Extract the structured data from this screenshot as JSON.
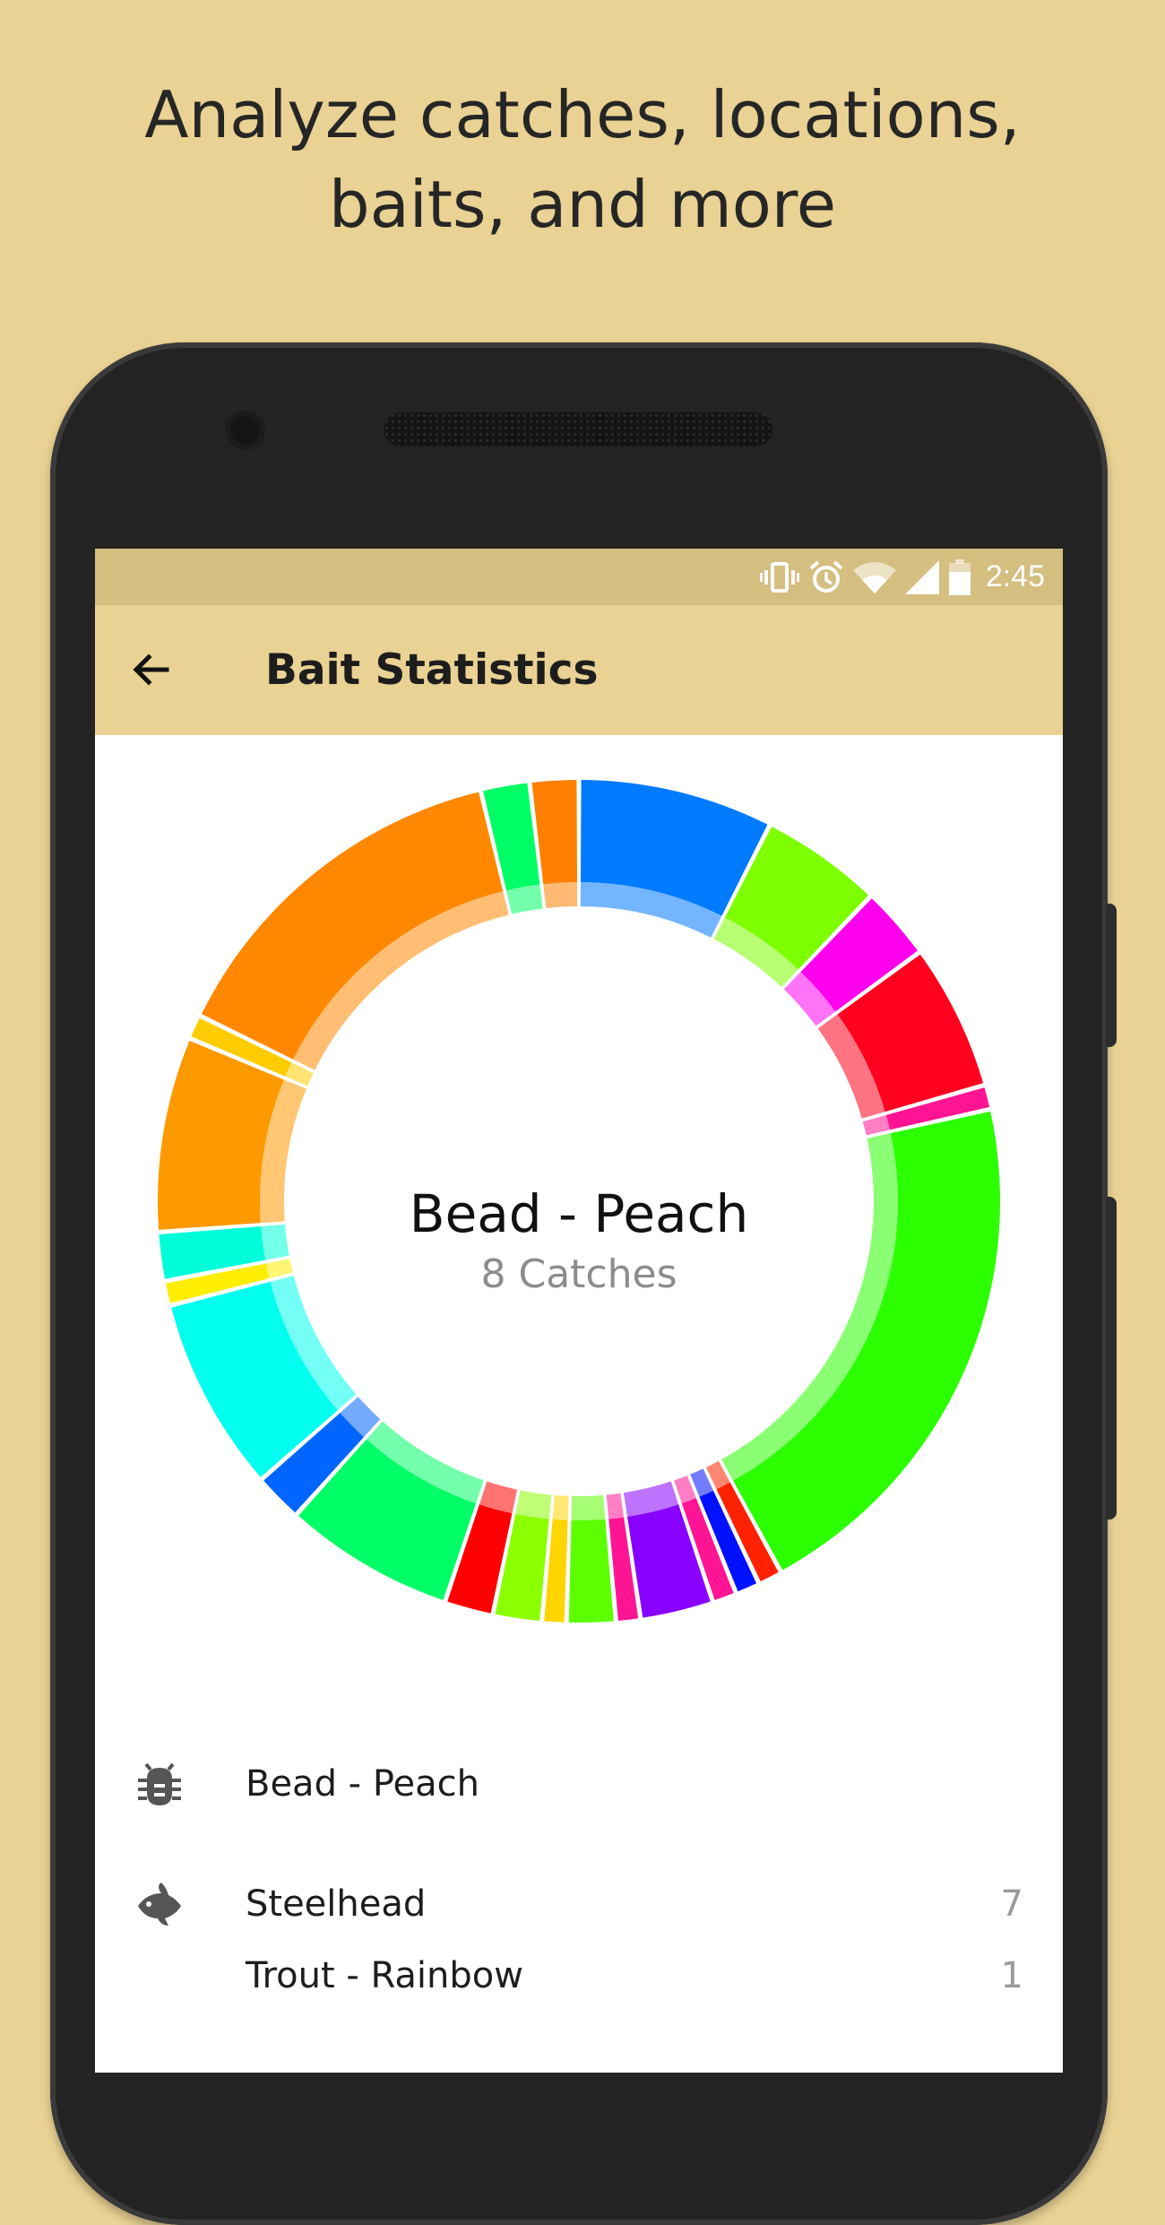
{
  "promo": {
    "line1": "Analyze catches, locations,",
    "line2": "baits, and more"
  },
  "status_bar": {
    "icons": [
      "vibrate-icon",
      "alarm-icon",
      "wifi-icon",
      "cell-signal-icon",
      "battery-icon"
    ],
    "time": "2:45"
  },
  "app_bar": {
    "back_icon": "arrow-back-icon",
    "title": "Bait Statistics"
  },
  "colors": {
    "background": "#e9d293",
    "status_bar": "#d4be80",
    "app_bar": "#e9d293"
  },
  "chart_data": {
    "type": "pie",
    "style": "donut",
    "center_label": "Bead - Peach",
    "center_sublabel": "8 Catches",
    "slices": [
      {
        "color": "#007aff",
        "value": 8
      },
      {
        "color": "#7dff00",
        "value": 5
      },
      {
        "color": "#ff00ee",
        "value": 3
      },
      {
        "color": "#ff001e",
        "value": 6
      },
      {
        "color": "#ff1493",
        "value": 1
      },
      {
        "color": "#2bff00",
        "value": 22
      },
      {
        "color": "#ff2200",
        "value": 1
      },
      {
        "color": "#0011ff",
        "value": 1
      },
      {
        "color": "#ff1493",
        "value": 1
      },
      {
        "color": "#8800ff",
        "value": 3
      },
      {
        "color": "#ff1493",
        "value": 1
      },
      {
        "color": "#5cff00",
        "value": 2
      },
      {
        "color": "#ffd500",
        "value": 1
      },
      {
        "color": "#8cff00",
        "value": 2
      },
      {
        "color": "#ff0000",
        "value": 2
      },
      {
        "color": "#00ff66",
        "value": 7
      },
      {
        "color": "#0066ff",
        "value": 2
      },
      {
        "color": "#00ffee",
        "value": 8
      },
      {
        "color": "#ffee00",
        "value": 1
      },
      {
        "color": "#00ffd9",
        "value": 2
      },
      {
        "color": "#ff9900",
        "value": 8
      },
      {
        "color": "#ffcc00",
        "value": 1
      },
      {
        "color": "#ff8800",
        "value": 15
      },
      {
        "color": "#00ff66",
        "value": 2
      },
      {
        "color": "#ff8000",
        "value": 2
      }
    ]
  },
  "details": {
    "bait_icon": "bug-icon",
    "bait_name": "Bead - Peach",
    "species_icon": "fish-icon",
    "species": [
      {
        "name": "Steelhead",
        "count": "7"
      },
      {
        "name": "Trout - Rainbow",
        "count": "1"
      }
    ]
  }
}
